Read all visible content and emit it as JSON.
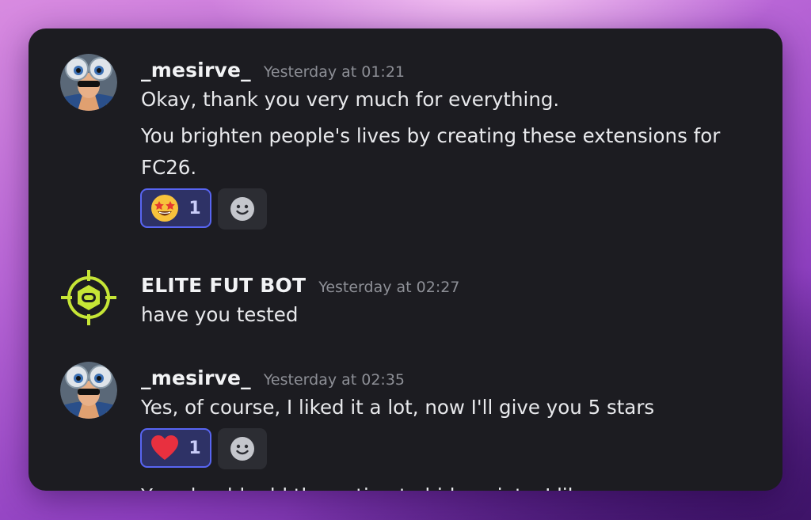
{
  "messages": [
    {
      "username": "_mesirve_",
      "timestamp": "Yesterday at 01:21",
      "lines": [
        "Okay, thank you very much for everything.",
        "You brighten people's lives by creating these extensions for FC26."
      ],
      "reaction": {
        "emoji": "star-struck-emoji",
        "count": "1"
      },
      "avatar": "sunglasses-character-avatar"
    },
    {
      "username": "ELITE FUT BOT",
      "timestamp": "Yesterday at 02:27",
      "lines": [
        "have you tested"
      ],
      "avatar": "green-football-crosshair-logo"
    },
    {
      "username": "_mesirve_",
      "timestamp": "Yesterday at 02:35",
      "lines": [
        "Yes, of course, I liked it a lot, now I'll give you 5 stars"
      ],
      "reaction": {
        "emoji": "red-heart-emoji",
        "count": "1"
      },
      "avatar": "sunglasses-character-avatar"
    }
  ],
  "partial_next_message": "You should add the option to hide points, I like",
  "colors": {
    "panel": "#1c1c21",
    "reaction_border": "#5865f2",
    "reaction_bg": "#2e3266",
    "bot_logo": "#c6e536"
  }
}
